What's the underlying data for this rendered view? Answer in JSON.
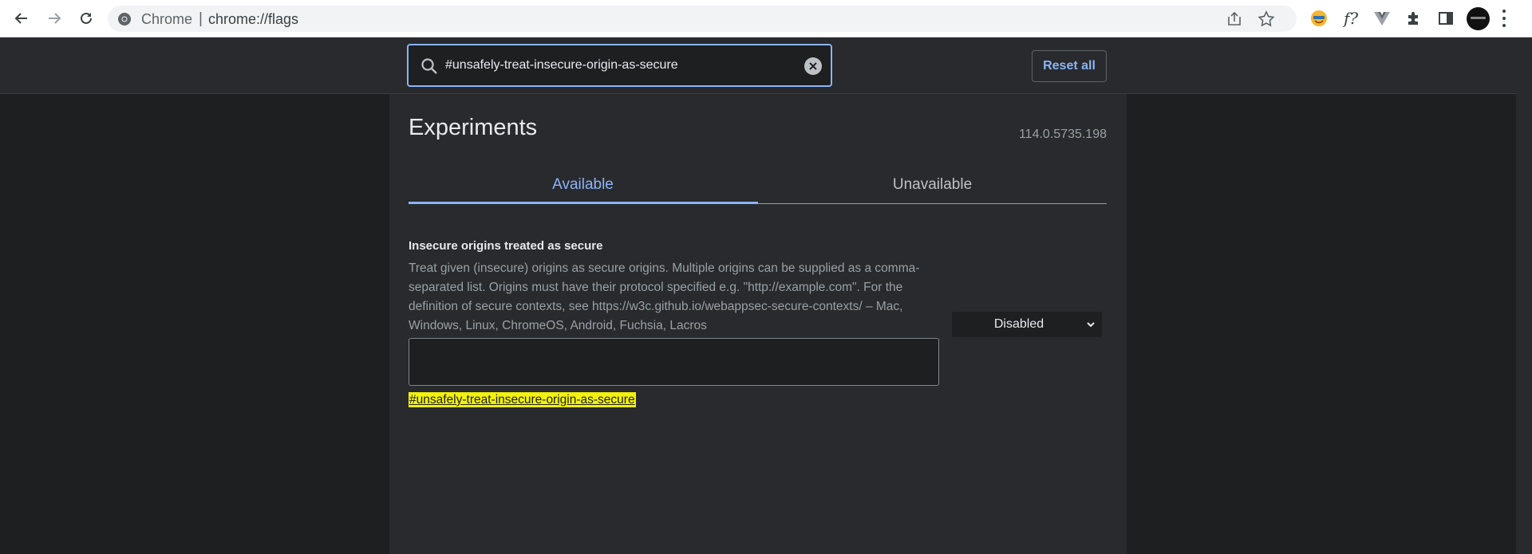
{
  "browser": {
    "site_label": "Chrome",
    "separator": "|",
    "url": "chrome://flags",
    "extensions": [
      {
        "name": "emoji-extension-icon"
      },
      {
        "name": "function-extension-icon",
        "label": "f?"
      },
      {
        "name": "vuejs-devtools-icon"
      },
      {
        "name": "puzzle-extensions-icon"
      },
      {
        "name": "side-panel-icon"
      }
    ]
  },
  "header": {
    "search_value": "#unsafely-treat-insecure-origin-as-secure",
    "reset_label": "Reset all"
  },
  "page": {
    "title": "Experiments",
    "version": "114.0.5735.198",
    "tabs": [
      {
        "label": "Available",
        "selected": true
      },
      {
        "label": "Unavailable",
        "selected": false
      }
    ]
  },
  "flag": {
    "title": "Insecure origins treated as secure",
    "description": "Treat given (insecure) origins as secure origins. Multiple origins can be supplied as a comma-separated list. Origins must have their protocol specified e.g. \"http://example.com\". For the definition of secure contexts, see https://w3c.github.io/webappsec-secure-contexts/ – Mac, Windows, Linux, ChromeOS, Android, Fuchsia, Lacros",
    "textarea_value": "",
    "anchor": "#unsafely-treat-insecure-origin-as-secure",
    "state": "Disabled"
  },
  "colors": {
    "accent": "#8ab4f8",
    "page_bg": "#1e1f21",
    "panel_bg": "#292a2d",
    "highlight": "#f2f20d"
  }
}
